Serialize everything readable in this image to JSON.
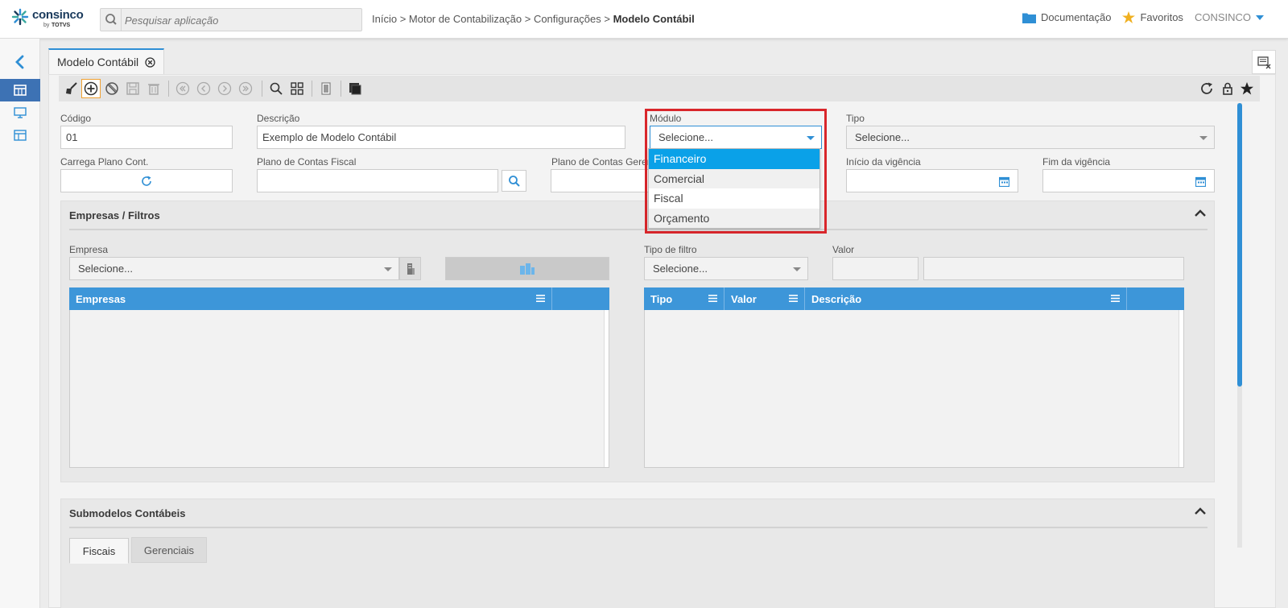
{
  "header": {
    "logo_text": "consinco",
    "logo_by": "by",
    "logo_totvs": "TOTVS",
    "search_placeholder": "Pesquisar aplicação",
    "breadcrumb": [
      "Início",
      "Motor de Contabilização",
      "Configurações"
    ],
    "breadcrumb_current": "Modelo Contábil",
    "breadcrumb_sep": " > ",
    "documentacao": "Documentação",
    "favoritos": "Favoritos",
    "user": "CONSINCO"
  },
  "tab": {
    "label": "Modelo Contábil"
  },
  "form": {
    "codigo_label": "Código",
    "codigo_value": "01",
    "descricao_label": "Descrição",
    "descricao_value": "Exemplo de Modelo Contábil",
    "modulo_label": "Módulo",
    "modulo_value": "Selecione...",
    "tipo_label": "Tipo",
    "tipo_value": "Selecione...",
    "carrega_label": "Carrega Plano Cont.",
    "plano_fiscal_label": "Plano de Contas Fiscal",
    "plano_gerencial_label": "Plano de Contas Gerencial",
    "inicio_label": "Início da vigência",
    "fim_label": "Fim da vigência"
  },
  "empresas_section": {
    "title": "Empresas / Filtros",
    "empresa_label": "Empresa",
    "empresa_value": "Selecione...",
    "tipo_filtro_label": "Tipo de filtro",
    "tipo_filtro_value": "Selecione...",
    "valor_label": "Valor",
    "grid_left_cols": [
      "Empresas"
    ],
    "grid_right_cols": [
      "Tipo",
      "Valor",
      "Descrição"
    ]
  },
  "submodelos_section": {
    "title": "Submodelos Contábeis",
    "tabs": [
      "Fiscais",
      "Gerenciais"
    ]
  },
  "modulo_dropdown": {
    "options": [
      "Financeiro",
      "Comercial",
      "Fiscal",
      "Orçamento"
    ],
    "selected": "Financeiro"
  },
  "colors": {
    "accent": "#2f8fd5",
    "grid_header": "#3d96d9",
    "dropdown_selected": "#0aa1e8",
    "highlight": "#d9262b"
  }
}
